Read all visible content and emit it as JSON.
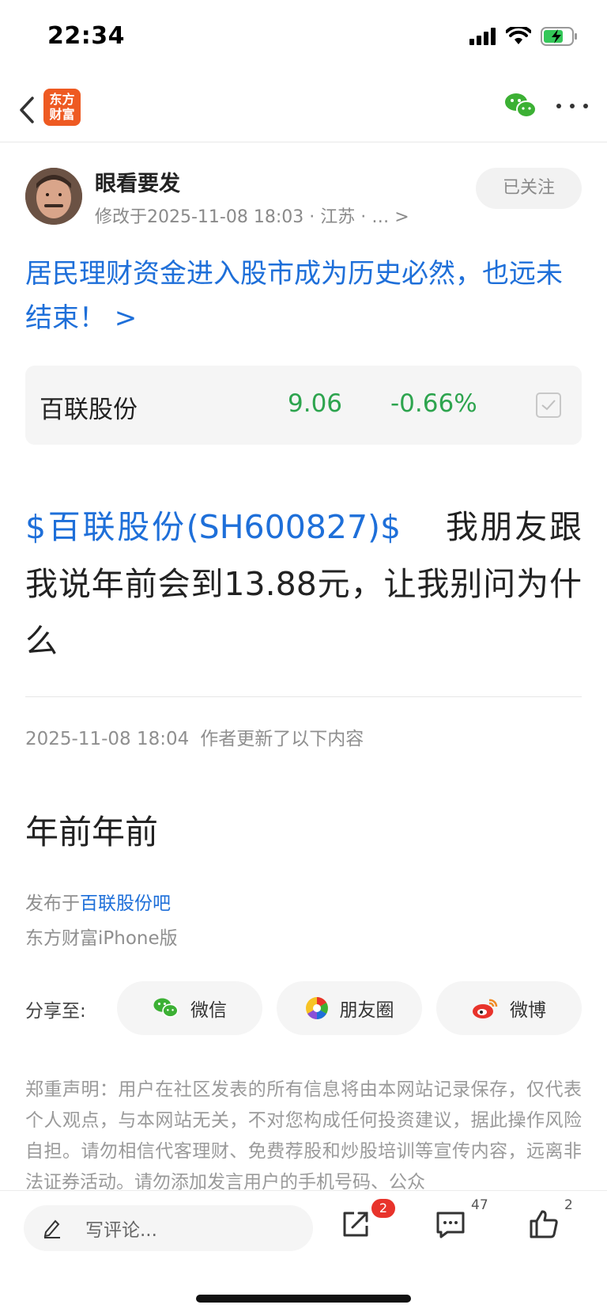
{
  "status_bar": {
    "time": "22:34"
  },
  "nav": {
    "logo_text": "东方财富"
  },
  "author": {
    "name": "眼看要发",
    "meta": "修改于2025-11-08 18:03  · 江苏  · …  >",
    "follow_label": "已关注"
  },
  "article": {
    "title": "居民理财资金进入股市成为历史必然，也远未结束！ >"
  },
  "stock_card": {
    "name": "百联股份",
    "price": "9.06",
    "change": "-0.66%",
    "color": "#2da44e"
  },
  "post": {
    "stock_tag": "$百联股份(SH600827)$",
    "text": "我朋友跟我说年前会到13.88元，让我别问为什么"
  },
  "update": {
    "timestamp": "2025-11-08 18:04",
    "label": "作者更新了以下内容",
    "content": "年前年前"
  },
  "publish": {
    "prefix": "发布于",
    "bar_name": "百联股份吧",
    "client": "东方财富iPhone版"
  },
  "share": {
    "label": "分享至:",
    "wechat": "微信",
    "moments": "朋友圈",
    "weibo": "微博"
  },
  "disclaimer": "郑重声明：用户在社区发表的所有信息将由本网站记录保存，仅代表个人观点，与本网站无关，不对您构成任何投资建议，据此操作风险自担。请勿相信代客理财、免费荐股和炒股培训等宣传内容，远离非法证券活动。请勿添加发言用户的手机号码、公众",
  "bottom_bar": {
    "comment_placeholder": "写评论...",
    "share_badge": "2",
    "comment_count": "47",
    "like_count": "2"
  },
  "colors": {
    "accent_blue": "#1e6fd9",
    "stock_green": "#2da44e",
    "brand_orange": "#ee5a22",
    "badge_red": "#e8332b"
  }
}
